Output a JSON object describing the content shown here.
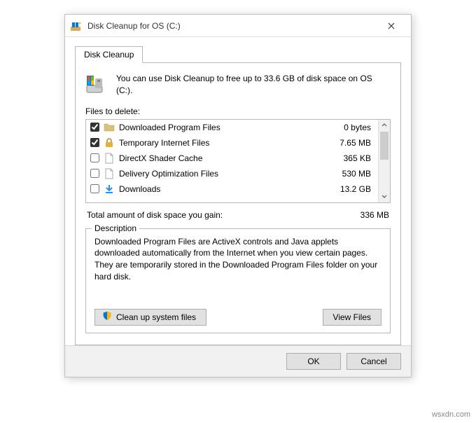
{
  "window": {
    "title": "Disk Cleanup for OS (C:)"
  },
  "tab": {
    "label": "Disk Cleanup"
  },
  "header": {
    "text": "You can use Disk Cleanup to free up to 33.6 GB of disk space on OS (C:)."
  },
  "filesLabel": "Files to delete:",
  "files": [
    {
      "checked": true,
      "name": "Downloaded Program Files",
      "size": "0 bytes",
      "icon": "folder"
    },
    {
      "checked": true,
      "name": "Temporary Internet Files",
      "size": "7.65 MB",
      "icon": "lock"
    },
    {
      "checked": false,
      "name": "DirectX Shader Cache",
      "size": "365 KB",
      "icon": "file"
    },
    {
      "checked": false,
      "name": "Delivery Optimization Files",
      "size": "530 MB",
      "icon": "file"
    },
    {
      "checked": false,
      "name": "Downloads",
      "size": "13.2 GB",
      "icon": "download"
    }
  ],
  "total": {
    "label": "Total amount of disk space you gain:",
    "value": "336 MB"
  },
  "description": {
    "legend": "Description",
    "text": "Downloaded Program Files are ActiveX controls and Java applets downloaded automatically from the Internet when you view certain pages. They are temporarily stored in the Downloaded Program Files folder on your hard disk."
  },
  "buttons": {
    "cleanSystem": "Clean up system files",
    "viewFiles": "View Files",
    "ok": "OK",
    "cancel": "Cancel"
  },
  "watermark": "wsxdn.com"
}
